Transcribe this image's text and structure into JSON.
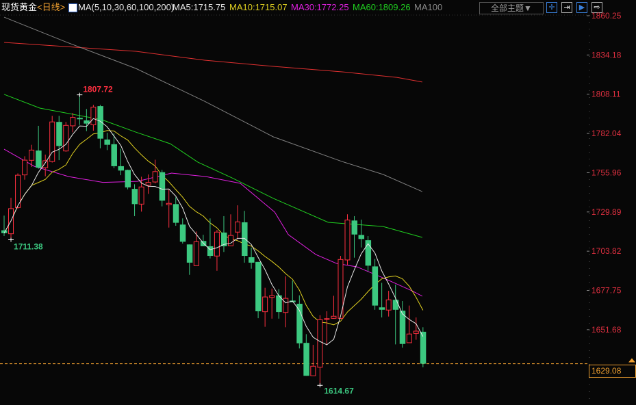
{
  "header": {
    "symbol": "现货黄金",
    "period": "<日线>",
    "indicator": "MA(5,10,30,60,100,200)",
    "ma5": "MA5:1715.75",
    "ma10": "MA10:1715.07",
    "ma30": "MA30:1772.25",
    "ma60": "MA60:1809.26",
    "ma100": "MA100",
    "theme_button": "全部主题▼"
  },
  "colors": {
    "up": "#ff3040",
    "down": "#3cc880",
    "ma5": "#e8e8e8",
    "ma10": "#e0d020",
    "ma30": "#e020e0",
    "ma60": "#20d020",
    "ma100": "#808080",
    "ma200": "#e03030",
    "axis": "#e03040",
    "current": "#f0a030"
  },
  "chart_data": {
    "type": "candlestick",
    "title": "现货黄金 日线",
    "y_ticks": [
      "1860.25",
      "1834.18",
      "1808.11",
      "1782.04",
      "1755.96",
      "1729.89",
      "1703.82",
      "1677.75",
      "1651.68"
    ],
    "ylim": [
      1860.25,
      1629.08
    ],
    "current_price": "1629.08",
    "annotations": {
      "high": "1807.72",
      "high_index": 11,
      "low_left": "1711.38",
      "low_left_index": 1,
      "low": "1614.67",
      "low_index": 46
    },
    "ohlc": [
      [
        1717.7,
        1727.5,
        1713.9,
        1715.8
      ],
      [
        1715.4,
        1739.3,
        1711.38,
        1732.1
      ],
      [
        1732.8,
        1755.5,
        1732.0,
        1754.3
      ],
      [
        1754.5,
        1766.9,
        1751.3,
        1764.3
      ],
      [
        1764.2,
        1774.5,
        1759.8,
        1771.0
      ],
      [
        1770.7,
        1787.1,
        1758.6,
        1759.3
      ],
      [
        1759.3,
        1768.0,
        1753.6,
        1763.9
      ],
      [
        1763.4,
        1793.7,
        1762.7,
        1789.7
      ],
      [
        1789.7,
        1793.7,
        1764.3,
        1773.7
      ],
      [
        1770.4,
        1789.7,
        1769.9,
        1787.4
      ],
      [
        1787.1,
        1795.7,
        1782.8,
        1792.7
      ],
      [
        1792.4,
        1807.72,
        1787.7,
        1791.5
      ],
      [
        1790.7,
        1798.3,
        1783.6,
        1788.6
      ],
      [
        1787.8,
        1801.0,
        1783.9,
        1799.5
      ],
      [
        1800.2,
        1801.0,
        1772.2,
        1778.6
      ],
      [
        1778.0,
        1782.5,
        1771.0,
        1774.5
      ],
      [
        1774.9,
        1782.1,
        1758.9,
        1760.3
      ],
      [
        1760.3,
        1771.9,
        1754.3,
        1757.4
      ],
      [
        1757.8,
        1758.0,
        1744.9,
        1746.2
      ],
      [
        1745.2,
        1748.3,
        1727.1,
        1735.1
      ],
      [
        1735.1,
        1753.3,
        1730.1,
        1746.5
      ],
      [
        1747.7,
        1754.8,
        1741.9,
        1749.5
      ],
      [
        1749.8,
        1764.6,
        1748.9,
        1756.7
      ],
      [
        1756.3,
        1757.8,
        1733.6,
        1737.4
      ],
      [
        1734.7,
        1744.7,
        1719.5,
        1735.6
      ],
      [
        1735.1,
        1739.7,
        1720.7,
        1722.7
      ],
      [
        1721.5,
        1725.6,
        1708.9,
        1710.1
      ],
      [
        1708.3,
        1708.3,
        1688.1,
        1696.2
      ],
      [
        1694.2,
        1716.9,
        1694.2,
        1710.1
      ],
      [
        1710.6,
        1714.7,
        1707.1,
        1707.1
      ],
      [
        1707.1,
        1725.6,
        1699.0,
        1700.7
      ],
      [
        1700.6,
        1718.0,
        1690.8,
        1716.5
      ],
      [
        1716.2,
        1727.1,
        1703.3,
        1707.1
      ],
      [
        1707.4,
        1728.3,
        1707.4,
        1714.3
      ],
      [
        1716.5,
        1734.3,
        1711.6,
        1723.3
      ],
      [
        1723.0,
        1730.6,
        1696.2,
        1700.7
      ],
      [
        1699.8,
        1706.3,
        1692.2,
        1696.2
      ],
      [
        1696.7,
        1696.7,
        1659.3,
        1663.9
      ],
      [
        1663.6,
        1679.5,
        1653.6,
        1673.4
      ],
      [
        1673.1,
        1679.0,
        1659.0,
        1674.3
      ],
      [
        1674.5,
        1678.6,
        1659.0,
        1663.4
      ],
      [
        1663.1,
        1687.1,
        1653.3,
        1672.5
      ],
      [
        1671.0,
        1684.3,
        1669.9,
        1669.9
      ],
      [
        1668.9,
        1674.5,
        1639.2,
        1642.6
      ],
      [
        1642.9,
        1648.7,
        1621.0,
        1621.0
      ],
      [
        1621.0,
        1641.6,
        1621.0,
        1627.4
      ],
      [
        1626.7,
        1661.3,
        1614.67,
        1658.3
      ],
      [
        1658.6,
        1663.9,
        1641.2,
        1659.0
      ],
      [
        1659.2,
        1674.2,
        1658.9,
        1660.6
      ],
      [
        1659.2,
        1700.7,
        1658.9,
        1698.3
      ],
      [
        1698.0,
        1728.3,
        1694.7,
        1724.5
      ],
      [
        1724.2,
        1727.1,
        1699.5,
        1714.9
      ],
      [
        1714.6,
        1724.8,
        1706.3,
        1711.9
      ],
      [
        1711.1,
        1713.9,
        1690.4,
        1694.2
      ],
      [
        1693.7,
        1698.7,
        1664.9,
        1667.7
      ],
      [
        1666.5,
        1682.8,
        1659.8,
        1664.9
      ],
      [
        1664.7,
        1677.5,
        1660.4,
        1671.5
      ],
      [
        1671.5,
        1681.6,
        1641.9,
        1664.9
      ],
      [
        1664.3,
        1670.7,
        1639.7,
        1642.2
      ],
      [
        1643.0,
        1667.7,
        1643.0,
        1648.8
      ],
      [
        1649.2,
        1659.8,
        1645.0,
        1650.7
      ],
      [
        1650.3,
        1653.3,
        1626.7,
        1629.08
      ]
    ],
    "ma_series": [
      {
        "name": "MA30",
        "color_key": "ma30",
        "points": [
          [
            0,
            1771.6
          ],
          [
            4.4,
            1760.2
          ],
          [
            9.4,
            1753.4
          ],
          [
            14.4,
            1749.5
          ],
          [
            19.4,
            1750.2
          ],
          [
            24.4,
            1755.7
          ],
          [
            29.4,
            1753.4
          ],
          [
            34.4,
            1748.9
          ],
          [
            39.4,
            1729.8
          ],
          [
            41.4,
            1714.8
          ],
          [
            45.4,
            1701.6
          ],
          [
            48.4,
            1695.7
          ],
          [
            51.4,
            1693.4
          ],
          [
            55.4,
            1685.7
          ],
          [
            59.4,
            1677.5
          ],
          [
            60.9,
            1673.9
          ]
        ]
      },
      {
        "name": "MA60",
        "color_key": "ma60",
        "points": [
          [
            0,
            1808.0
          ],
          [
            5.2,
            1798.9
          ],
          [
            14.2,
            1791.2
          ],
          [
            19.2,
            1782.9
          ],
          [
            24.2,
            1775.2
          ],
          [
            28.2,
            1763.0
          ],
          [
            33.2,
            1752.5
          ],
          [
            39.2,
            1738.9
          ],
          [
            47.2,
            1723.0
          ],
          [
            51.2,
            1721.6
          ],
          [
            55.2,
            1720.2
          ],
          [
            60.9,
            1713.0
          ]
        ]
      },
      {
        "name": "MA100",
        "color_key": "ma100",
        "points": [
          [
            0,
            1859.3
          ],
          [
            9.2,
            1842.5
          ],
          [
            19.2,
            1825.2
          ],
          [
            29.2,
            1803.4
          ],
          [
            39.2,
            1779.8
          ],
          [
            49.2,
            1763.4
          ],
          [
            55.2,
            1754.8
          ],
          [
            60.9,
            1743.4
          ]
        ]
      },
      {
        "name": "MA200",
        "color_key": "ma200",
        "points": [
          [
            0,
            1842.5
          ],
          [
            19.2,
            1836.6
          ],
          [
            29.2,
            1830.7
          ],
          [
            39.2,
            1826.6
          ],
          [
            49.2,
            1823.0
          ],
          [
            57.2,
            1819.3
          ],
          [
            60.9,
            1816.2
          ]
        ]
      }
    ]
  }
}
